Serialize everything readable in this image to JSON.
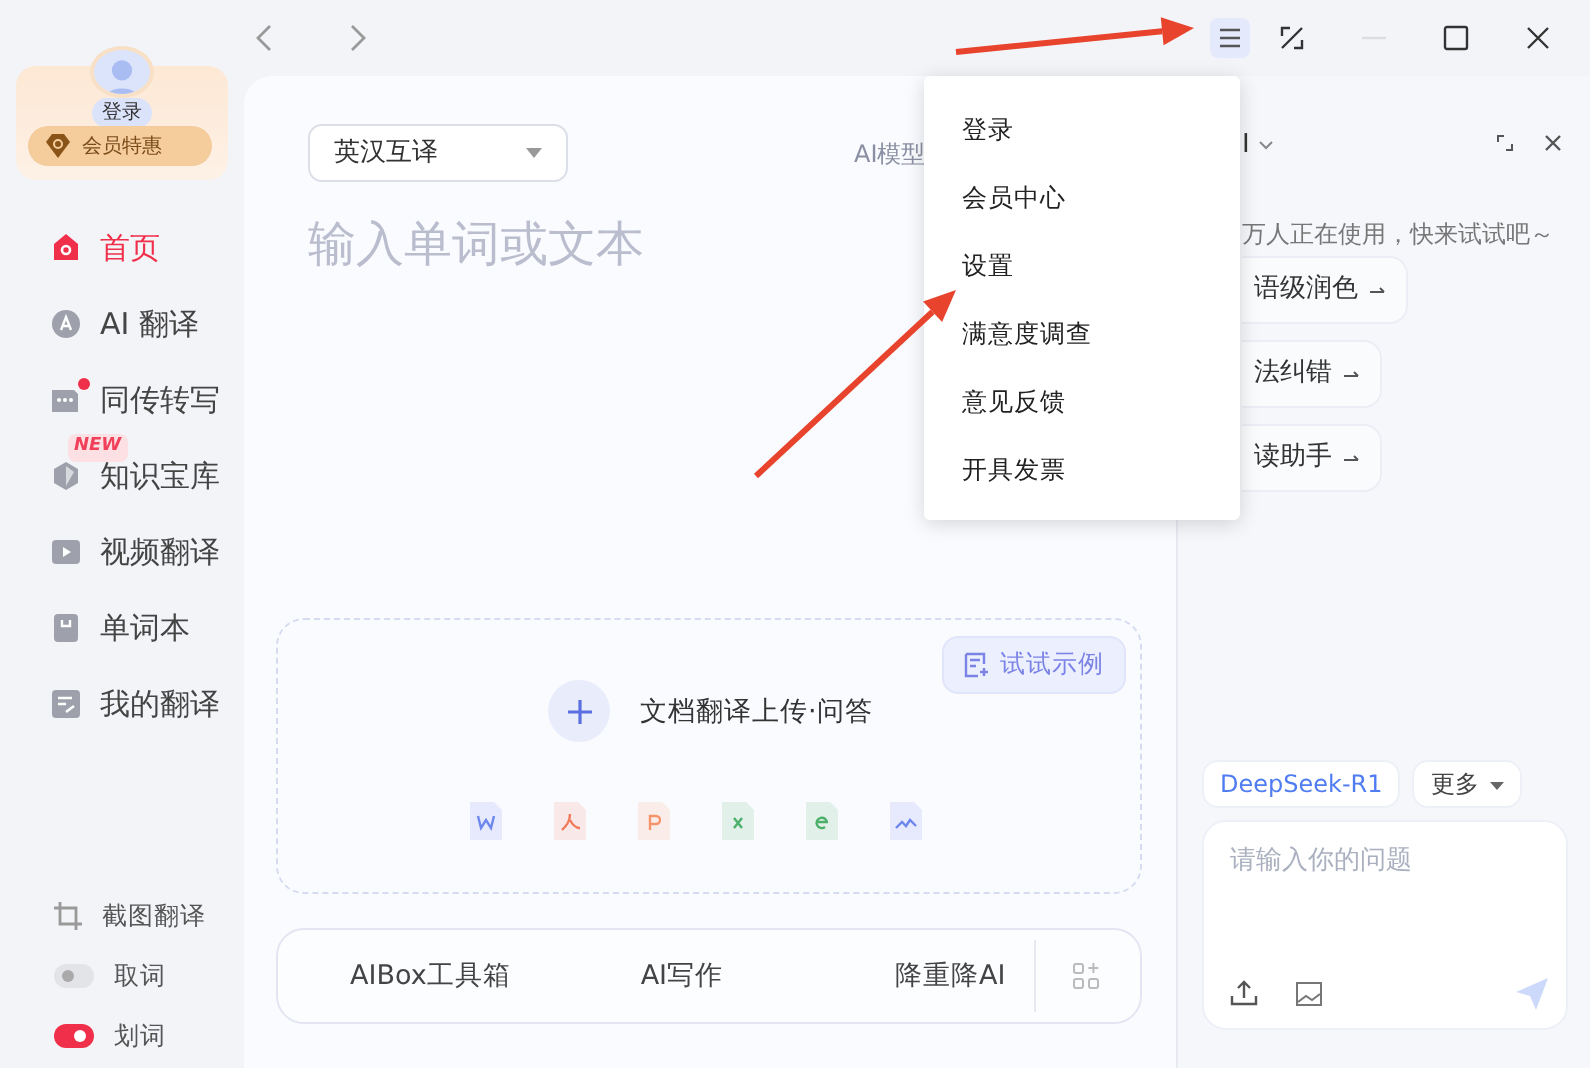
{
  "sidebar": {
    "login": "登录",
    "vip": "会员特惠",
    "items": [
      {
        "label": "首页",
        "selected": true
      },
      {
        "label": "AI 翻译",
        "selected": false
      },
      {
        "label": "同传转写",
        "selected": false,
        "dot": true
      },
      {
        "label": "知识宝库",
        "selected": false,
        "badge": "NEW"
      },
      {
        "label": "视频翻译",
        "selected": false
      },
      {
        "label": "单词本",
        "selected": false
      },
      {
        "label": "我的翻译",
        "selected": false
      }
    ],
    "tools": [
      {
        "kind": "action",
        "label": "截图翻译"
      },
      {
        "kind": "toggle",
        "label": "取词",
        "on": false
      },
      {
        "kind": "toggle",
        "label": "划词",
        "on": true
      }
    ]
  },
  "main": {
    "language": "英汉互译",
    "model_label": "AI模型",
    "placeholder": "输入单词或文本",
    "upload": {
      "label": "文档翻译上传·问答",
      "sample_button": "试试示例"
    },
    "toolbar": [
      "AIBox工具箱",
      "AI写作",
      "降重降AI"
    ]
  },
  "menu": [
    "登录",
    "会员中心",
    "设置",
    "满意度调查",
    "意见反馈",
    "开具发票"
  ],
  "assistant": {
    "title": "I",
    "tagline": "万人正在使用，快来试试吧～",
    "suggestions": [
      "语级润色",
      "法纠错",
      "读助手"
    ],
    "models": [
      {
        "label": "DeepSeek-R1",
        "selected": true
      },
      {
        "label": "更多",
        "selected": false,
        "dropdown": true
      }
    ],
    "placeholder": "请输入你的问题"
  },
  "annotations": [
    {
      "kind": "arrow"
    },
    {
      "kind": "arrow"
    }
  ]
}
